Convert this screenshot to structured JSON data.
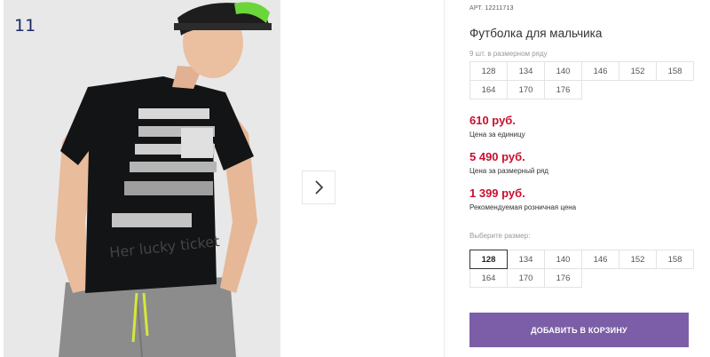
{
  "gallery": {
    "slide_number": "11",
    "next_icon": "chevron-right-icon"
  },
  "product": {
    "article_label": "АРТ.",
    "article_value": "12211713",
    "title": "Футболка для мальчика",
    "pack_label": "9 шт. в размерном ряду",
    "pack_sizes": [
      "128",
      "134",
      "140",
      "146",
      "152",
      "158",
      "164",
      "170",
      "176"
    ],
    "price_unit": "610 руб.",
    "price_unit_note": "Цена за единицу",
    "price_pack": "5 490 руб.",
    "price_pack_note": "Цена за размерный ряд",
    "price_retail": "1 399 руб.",
    "price_retail_note": "Рекомендуемая розничная цена",
    "choose_size_label": "Выберите размер:",
    "sizes": [
      "128",
      "134",
      "140",
      "146",
      "152",
      "158",
      "164",
      "170",
      "176"
    ],
    "selected_size": "128",
    "add_to_cart": "ДОБАВИТЬ В КОРЗИНУ"
  },
  "colors": {
    "price": "#c8102e",
    "button": "#7b5ea7"
  }
}
